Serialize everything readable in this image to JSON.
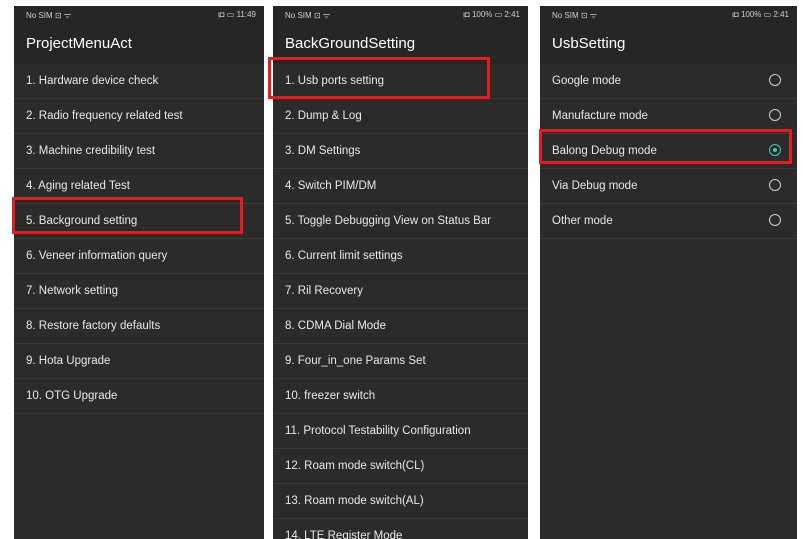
{
  "screen1": {
    "status": {
      "left": "No SIM ⊡ ᯤ",
      "right": "ᴉ◘ ▭ 11:49"
    },
    "title": "ProjectMenuAct",
    "items": [
      "1. Hardware device check",
      "2. Radio frequency related test",
      "3. Machine credibility test",
      "4. Aging related Test",
      "5. Background setting",
      "6. Veneer information query",
      "7. Network setting",
      "8. Restore factory defaults",
      "9. Hota Upgrade",
      "10. OTG Upgrade"
    ]
  },
  "screen2": {
    "status": {
      "left": "No SIM ⊡ ᯤ",
      "right": "ᴉ◘ 100% ▭ 2:41"
    },
    "title": "BackGroundSetting",
    "items": [
      "1. Usb ports setting",
      "2. Dump & Log",
      "3. DM Settings",
      "4. Switch PIM/DM",
      "5. Toggle Debugging View on Status Bar",
      "6. Current limit settings",
      "7. Ril Recovery",
      "8. CDMA Dial Mode",
      "9. Four_in_one Params Set",
      "10. freezer switch",
      "11. Protocol Testability Configuration",
      "12. Roam mode switch(CL)",
      "13. Roam mode switch(AL)",
      "14. LTE Register Mode"
    ]
  },
  "screen3": {
    "status": {
      "left": "No SIM ⊡ ᯤ",
      "right": "ᴉ◘ 100% ▭ 2:41"
    },
    "title": "UsbSetting",
    "options": [
      {
        "label": "Google mode",
        "selected": false
      },
      {
        "label": "Manufacture mode",
        "selected": false
      },
      {
        "label": "Balong Debug mode",
        "selected": true
      },
      {
        "label": "Via Debug mode",
        "selected": false
      },
      {
        "label": "Other mode",
        "selected": false
      }
    ]
  },
  "colors": {
    "background": "#2b2b2b",
    "header": "#262626",
    "highlight": "#e41e1e",
    "radio_checked": "#45c6b4"
  }
}
